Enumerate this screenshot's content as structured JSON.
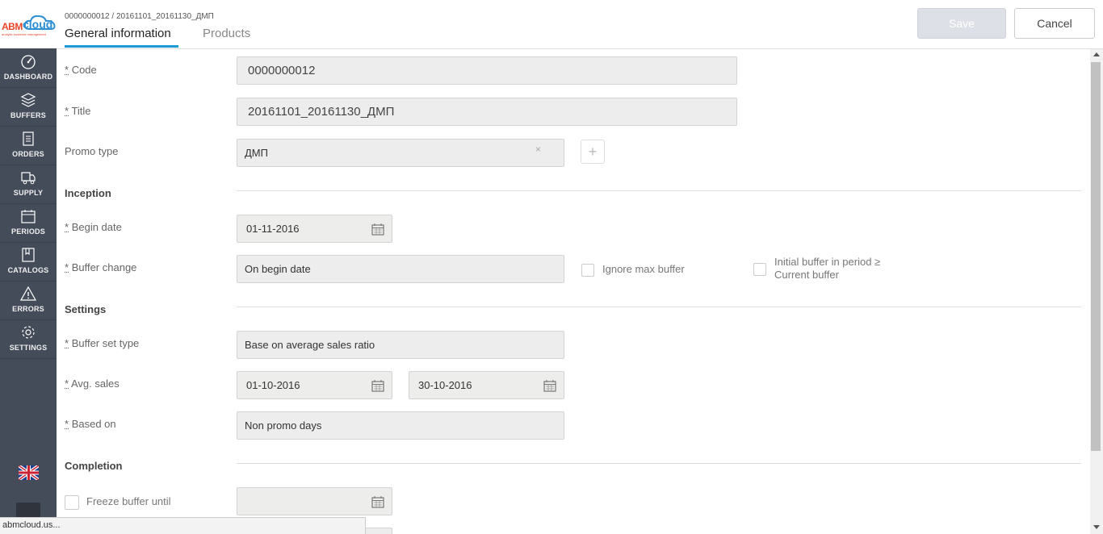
{
  "logo": {
    "abm": "ABM",
    "cloud": "cloud",
    "tagline": "analytic business management"
  },
  "breadcrumb": "0000000012 / 20161101_20161130_ДМП",
  "tabs": [
    {
      "label": "General information",
      "active": true
    },
    {
      "label": "Products",
      "active": false
    }
  ],
  "actions": {
    "save": "Save",
    "cancel": "Cancel"
  },
  "sidebar": {
    "items": [
      {
        "label": "DASHBOARD",
        "icon": "dashboard-icon"
      },
      {
        "label": "BUFFERS",
        "icon": "layers-icon"
      },
      {
        "label": "ORDERS",
        "icon": "document-icon"
      },
      {
        "label": "SUPPLY",
        "icon": "truck-icon"
      },
      {
        "label": "PERIODS",
        "icon": "calendar-icon"
      },
      {
        "label": "CATALOGS",
        "icon": "catalog-icon"
      },
      {
        "label": "ERRORS",
        "icon": "warning-icon"
      },
      {
        "label": "SETTINGS",
        "icon": "gear-icon"
      }
    ],
    "language_icon": "uk-flag-icon"
  },
  "form": {
    "code": {
      "star": "*",
      "label": "Code",
      "value": "0000000012"
    },
    "title": {
      "star": "*",
      "label": "Title",
      "value": "20161101_20161130_ДМП"
    },
    "promo_type": {
      "label": "Promo type",
      "value": "ДМП",
      "clear": "×",
      "add": "+"
    },
    "inception": {
      "heading": "Inception"
    },
    "begin_date": {
      "star": "*",
      "label": "Begin date",
      "value": "01-11-2016"
    },
    "buffer_change": {
      "star": "*",
      "label": "Buffer change",
      "value": "On begin date"
    },
    "ignore_max_buffer": {
      "label": "Ignore max buffer",
      "checked": false
    },
    "initial_buffer": {
      "label_line1": "Initial buffer in period ≥",
      "label_line2": "Current buffer",
      "checked": false
    },
    "settings": {
      "heading": "Settings"
    },
    "buffer_set_type": {
      "star": "*",
      "label": "Buffer set type",
      "value": "Base on average sales ratio"
    },
    "avg_sales": {
      "star": "*",
      "label": "Avg. sales",
      "from": "01-10-2016",
      "to": "30-10-2016"
    },
    "based_on": {
      "star": "*",
      "label": "Based on",
      "value": "Non promo days"
    },
    "completion": {
      "heading": "Completion"
    },
    "freeze_buffer": {
      "label": "Freeze buffer until",
      "checked": false,
      "value": ""
    }
  },
  "status_bar": "abmcloud.us..."
}
